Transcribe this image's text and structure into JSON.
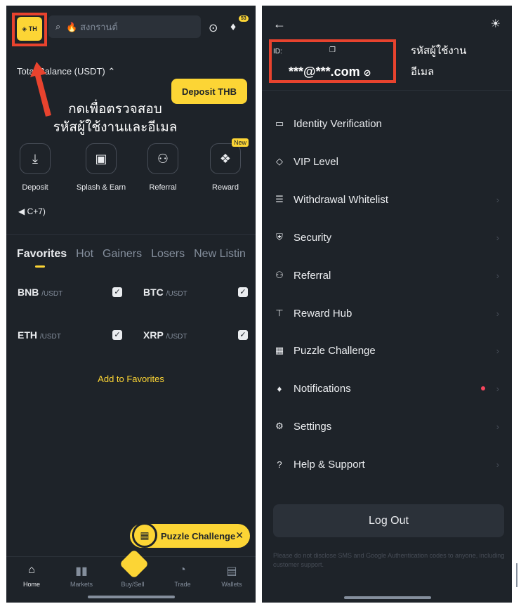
{
  "left": {
    "logo_text": "TH",
    "search_placeholder": "🔥 สงกรานต์",
    "notification_count": "53",
    "balance_label": "Total Balance (USDT) ⌃",
    "deposit_thb": "Deposit THB",
    "annotation": "กดเพื่อตรวจสอบ\nรหัสผู้ใช้งานและอีเมล",
    "quick_actions": [
      {
        "label": "Deposit",
        "icon": "download-icon"
      },
      {
        "label": "Splash & Earn",
        "icon": "gamepad-icon"
      },
      {
        "label": "Referral",
        "icon": "add-user-icon"
      },
      {
        "label": "Reward",
        "icon": "gift-icon",
        "badge": "New"
      }
    ],
    "announcement": "C+7)",
    "tabs": [
      "Favorites",
      "Hot",
      "Gainers",
      "Losers",
      "New Listin"
    ],
    "favorites": [
      {
        "base": "BNB",
        "quote": "/USDT"
      },
      {
        "base": "BTC",
        "quote": "/USDT"
      },
      {
        "base": "ETH",
        "quote": "/USDT"
      },
      {
        "base": "XRP",
        "quote": "/USDT"
      }
    ],
    "add_to_favorites": "Add to Favorites",
    "puzzle_pill": "Puzzle Challenge",
    "nav": [
      {
        "label": "Home",
        "icon": "home-icon"
      },
      {
        "label": "Markets",
        "icon": "bar-chart-icon"
      },
      {
        "label": "Buy/Sell",
        "icon": "buy-sell-icon"
      },
      {
        "label": "Trade",
        "icon": "trade-icon"
      },
      {
        "label": "Wallets",
        "icon": "wallet-icon"
      }
    ]
  },
  "right": {
    "uid_label": "ID:",
    "email": "***@***.com",
    "annotation_uid": "รหัสผู้ใช้งาน",
    "annotation_email": "อีเมล",
    "menu": [
      {
        "label": "Identity Verification",
        "icon": "id-card-icon",
        "chevron": false
      },
      {
        "label": "VIP Level",
        "icon": "diamond-icon",
        "chevron": false
      },
      {
        "label": "Withdrawal Whitelist",
        "icon": "list-icon",
        "chevron": true
      },
      {
        "label": "Security",
        "icon": "shield-icon",
        "chevron": true
      },
      {
        "label": "Referral",
        "icon": "add-user-icon",
        "chevron": true
      },
      {
        "label": "Reward Hub",
        "icon": "reward-icon",
        "chevron": true
      },
      {
        "label": "Puzzle Challenge",
        "icon": "puzzle-icon",
        "chevron": true
      },
      {
        "label": "Notifications",
        "icon": "bell-icon",
        "chevron": true,
        "dot": true
      },
      {
        "label": "Settings",
        "icon": "gear-icon",
        "chevron": true
      },
      {
        "label": "Help & Support",
        "icon": "help-icon",
        "chevron": true
      }
    ],
    "logout": "Log Out",
    "disclaimer": "Please do not disclose SMS and Google Authentication codes to anyone, including customer support."
  },
  "colors": {
    "accent": "#fcd535",
    "bg": "#1e2329",
    "annotation": "#e8432e",
    "alert": "#f6465d"
  }
}
